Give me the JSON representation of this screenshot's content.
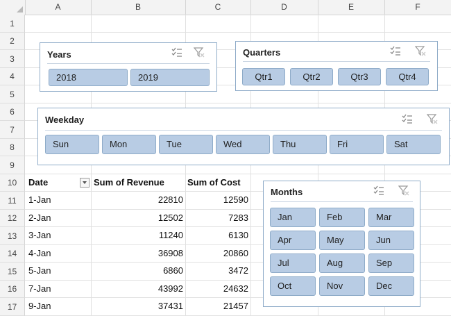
{
  "columns": [
    "A",
    "B",
    "C",
    "D",
    "E",
    "F"
  ],
  "rows": [
    "1",
    "2",
    "3",
    "4",
    "5",
    "6",
    "7",
    "8",
    "9",
    "10",
    "11",
    "12",
    "13",
    "14",
    "15",
    "16",
    "17"
  ],
  "table": {
    "headers": {
      "date": "Date",
      "revenue": "Sum of Revenue",
      "cost": "Sum of Cost"
    },
    "rows": [
      {
        "date": "1-Jan",
        "revenue": "22810",
        "cost": "12590"
      },
      {
        "date": "2-Jan",
        "revenue": "12502",
        "cost": "7283"
      },
      {
        "date": "3-Jan",
        "revenue": "11240",
        "cost": "6130"
      },
      {
        "date": "4-Jan",
        "revenue": "36908",
        "cost": "20860"
      },
      {
        "date": "5-Jan",
        "revenue": "6860",
        "cost": "3472"
      },
      {
        "date": "7-Jan",
        "revenue": "43992",
        "cost": "24632"
      },
      {
        "date": "9-Jan",
        "revenue": "37431",
        "cost": "21457"
      }
    ]
  },
  "slicers": {
    "years": {
      "title": "Years",
      "items": [
        "2018",
        "2019"
      ]
    },
    "quarters": {
      "title": "Quarters",
      "items": [
        "Qtr1",
        "Qtr2",
        "Qtr3",
        "Qtr4"
      ]
    },
    "weekday": {
      "title": "Weekday",
      "items": [
        "Sun",
        "Mon",
        "Tue",
        "Wed",
        "Thu",
        "Fri",
        "Sat"
      ]
    },
    "months": {
      "title": "Months",
      "items": [
        "Jan",
        "Feb",
        "Mar",
        "Apr",
        "May",
        "Jun",
        "Jul",
        "Aug",
        "Sep",
        "Oct",
        "Nov",
        "Dec"
      ]
    }
  },
  "icons": {
    "multi_select": "multi-select-icon",
    "clear_filter": "clear-filter-icon"
  },
  "colors": {
    "slicer_button": "#b8cce4",
    "slicer_border": "#8eabc8",
    "header_bg": "#f3f3f3"
  }
}
